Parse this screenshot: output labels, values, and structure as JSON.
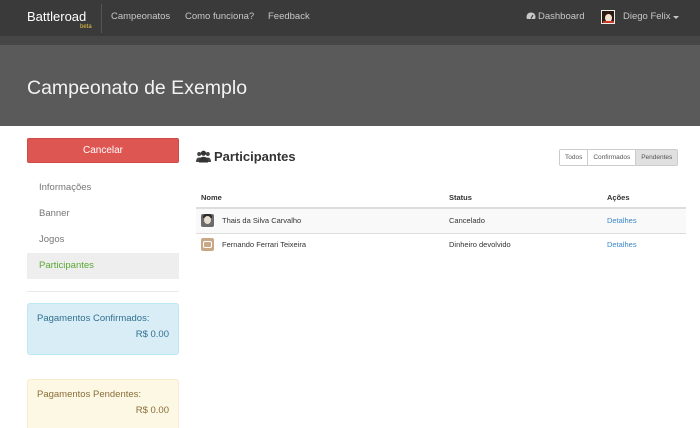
{
  "navbar": {
    "brand": "Battleroad",
    "beta": "beta",
    "links": [
      "Campeonatos",
      "Como funciona?",
      "Feedback"
    ],
    "dashboard": "Dashboard",
    "user": "Diego Felix"
  },
  "header": {
    "title": "Campeonato de Exemplo"
  },
  "sidebar": {
    "cancel_label": "Cancelar",
    "items": [
      {
        "label": "Informações",
        "active": false
      },
      {
        "label": "Banner",
        "active": false
      },
      {
        "label": "Jogos",
        "active": false
      },
      {
        "label": "Participantes",
        "active": true
      }
    ],
    "confirmed": {
      "label": "Pagamentos Confirmados:",
      "value": "R$ 0.00"
    },
    "pending": {
      "label": "Pagamentos Pendentes:",
      "value": "R$ 0.00"
    }
  },
  "main": {
    "title": "Participantes",
    "filters": [
      {
        "label": "Todos",
        "active": false
      },
      {
        "label": "Confirmados",
        "active": false
      },
      {
        "label": "Pendentes",
        "active": true
      }
    ],
    "table": {
      "headers": [
        "Nome",
        "Status",
        "Ações"
      ],
      "rows": [
        {
          "name": "Thais da Silva Carvalho",
          "status": "Cancelado",
          "action": "Detalhes"
        },
        {
          "name": "Fernando Ferrari Teixeira",
          "status": "Dinheiro devolvido",
          "action": "Detalhes"
        }
      ]
    }
  },
  "colors": {
    "navbar": "#3a3a3a",
    "header": "#5a5a5a",
    "danger": "#de5652",
    "active_link": "#5aa832",
    "link": "#3a87c8"
  },
  "icons": [
    "dashboard-icon",
    "user-avatar",
    "caret-down-icon",
    "users-icon"
  ]
}
